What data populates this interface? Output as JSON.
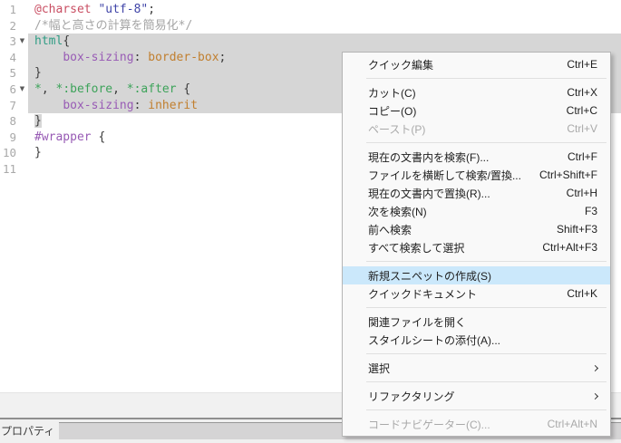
{
  "editor": {
    "token_colors": {
      "atrule": "#c94f63",
      "string": "#4045a8",
      "comment": "#a5a5a5",
      "tag": "#2f9c84",
      "property": "#985bb5",
      "value": "#c17f2f",
      "selector": "#3da35a",
      "id": "#985bb5",
      "plain": "#3b3b3b"
    },
    "selection_color": "#d6d6d6",
    "fold_icon": "▼",
    "lines": [
      {
        "num": "1",
        "fold": false,
        "selected": "none",
        "tokens": [
          {
            "t": "@charset",
            "c": "atrule"
          },
          {
            "t": " ",
            "c": "plain"
          },
          {
            "t": "\"utf-8\"",
            "c": "string"
          },
          {
            "t": ";",
            "c": "plain"
          }
        ]
      },
      {
        "num": "2",
        "fold": false,
        "selected": "none",
        "tokens": [
          {
            "t": "/*幅と高さの計算を簡易化*/",
            "c": "comment"
          }
        ]
      },
      {
        "num": "3",
        "fold": true,
        "selected": "full",
        "tokens": [
          {
            "t": "html",
            "c": "tag"
          },
          {
            "t": "{",
            "c": "plain"
          }
        ]
      },
      {
        "num": "4",
        "fold": false,
        "selected": "full",
        "tokens": [
          {
            "t": "    ",
            "c": "plain"
          },
          {
            "t": "box-sizing",
            "c": "property"
          },
          {
            "t": ": ",
            "c": "plain"
          },
          {
            "t": "border-box",
            "c": "value"
          },
          {
            "t": ";",
            "c": "plain"
          }
        ]
      },
      {
        "num": "5",
        "fold": false,
        "selected": "full",
        "tokens": [
          {
            "t": "}",
            "c": "plain"
          }
        ]
      },
      {
        "num": "6",
        "fold": true,
        "selected": "full",
        "tokens": [
          {
            "t": "*",
            "c": "selector"
          },
          {
            "t": ", ",
            "c": "plain"
          },
          {
            "t": "*",
            "c": "selector"
          },
          {
            "t": ":before",
            "c": "selector"
          },
          {
            "t": ", ",
            "c": "plain"
          },
          {
            "t": "*",
            "c": "selector"
          },
          {
            "t": ":after",
            "c": "selector"
          },
          {
            "t": " {",
            "c": "plain"
          }
        ]
      },
      {
        "num": "7",
        "fold": false,
        "selected": "full",
        "tokens": [
          {
            "t": "    ",
            "c": "plain"
          },
          {
            "t": "box-sizing",
            "c": "property"
          },
          {
            "t": ": ",
            "c": "plain"
          },
          {
            "t": "inherit",
            "c": "value"
          }
        ]
      },
      {
        "num": "8",
        "fold": false,
        "selected": "none",
        "tokens": [
          {
            "t": "}",
            "c": "plain",
            "sel": true
          }
        ]
      },
      {
        "num": "9",
        "fold": false,
        "selected": "none",
        "tokens": [
          {
            "t": "#wrapper",
            "c": "id"
          },
          {
            "t": " {",
            "c": "plain"
          }
        ]
      },
      {
        "num": "10",
        "fold": false,
        "selected": "none",
        "tokens": [
          {
            "t": "}",
            "c": "plain"
          }
        ]
      },
      {
        "num": "11",
        "fold": false,
        "selected": "none",
        "tokens": []
      }
    ]
  },
  "context_menu": {
    "highlight_color": "#cbe8fb",
    "items": [
      {
        "type": "item",
        "name": "quick-edit",
        "label": "クイック編集",
        "shortcut": "Ctrl+E"
      },
      {
        "type": "separator"
      },
      {
        "type": "item",
        "name": "cut",
        "label": "カット(C)",
        "shortcut": "Ctrl+X"
      },
      {
        "type": "item",
        "name": "copy",
        "label": "コピー(O)",
        "shortcut": "Ctrl+C"
      },
      {
        "type": "item",
        "name": "paste",
        "label": "ペースト(P)",
        "shortcut": "Ctrl+V",
        "disabled": true
      },
      {
        "type": "separator"
      },
      {
        "type": "item",
        "name": "find-in-document",
        "label": "現在の文書内を検索(F)...",
        "shortcut": "Ctrl+F"
      },
      {
        "type": "item",
        "name": "find-replace-in-files",
        "label": "ファイルを横断して検索/置換...",
        "shortcut": "Ctrl+Shift+F"
      },
      {
        "type": "item",
        "name": "replace-in-document",
        "label": "現在の文書内で置換(R)...",
        "shortcut": "Ctrl+H"
      },
      {
        "type": "item",
        "name": "find-next",
        "label": "次を検索(N)",
        "shortcut": "F3"
      },
      {
        "type": "item",
        "name": "find-previous",
        "label": "前へ検索",
        "shortcut": "Shift+F3"
      },
      {
        "type": "item",
        "name": "select-all-matches",
        "label": "すべて検索して選択",
        "shortcut": "Ctrl+Alt+F3"
      },
      {
        "type": "separator"
      },
      {
        "type": "item",
        "name": "create-new-snippet",
        "label": "新規スニペットの作成(S)",
        "shortcut": "",
        "highlighted": true
      },
      {
        "type": "item",
        "name": "quick-docs",
        "label": "クイックドキュメント",
        "shortcut": "Ctrl+K"
      },
      {
        "type": "separator"
      },
      {
        "type": "item",
        "name": "open-related-file",
        "label": "関連ファイルを開く",
        "shortcut": ""
      },
      {
        "type": "item",
        "name": "attach-stylesheet",
        "label": "スタイルシートの添付(A)...",
        "shortcut": ""
      },
      {
        "type": "separator"
      },
      {
        "type": "item",
        "name": "select",
        "label": "選択",
        "shortcut": "",
        "submenu": true
      },
      {
        "type": "separator"
      },
      {
        "type": "item",
        "name": "refactoring",
        "label": "リファクタリング",
        "shortcut": "",
        "submenu": true
      },
      {
        "type": "separator"
      },
      {
        "type": "item",
        "name": "code-navigator",
        "label": "コードナビゲーター(C)...",
        "shortcut": "Ctrl+Alt+N",
        "disabled": true
      }
    ]
  },
  "bottom_panel": {
    "tab_label": "プロパティ"
  }
}
